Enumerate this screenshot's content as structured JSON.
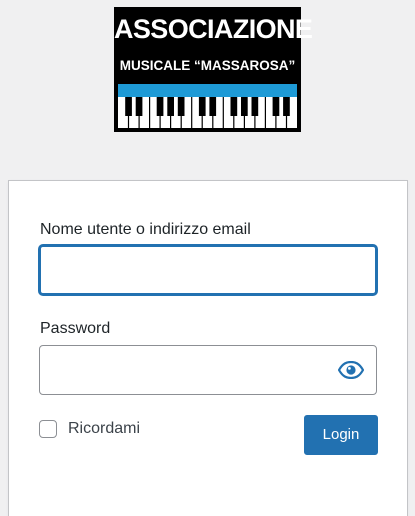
{
  "logo": {
    "line1": "ASSOCIAZIONE",
    "line2": "MUSICALE “MASSAROSA”",
    "stripe_color": "#1e9ad6"
  },
  "form": {
    "username_label": "Nome utente o indirizzo email",
    "username_value": "",
    "password_label": "Password",
    "password_value": "",
    "show_password_icon": "eye-icon",
    "remember_label": "Ricordami",
    "remember_checked": false,
    "submit_label": "Login"
  },
  "colors": {
    "accent": "#2271b1",
    "background": "#f0f0f1"
  }
}
